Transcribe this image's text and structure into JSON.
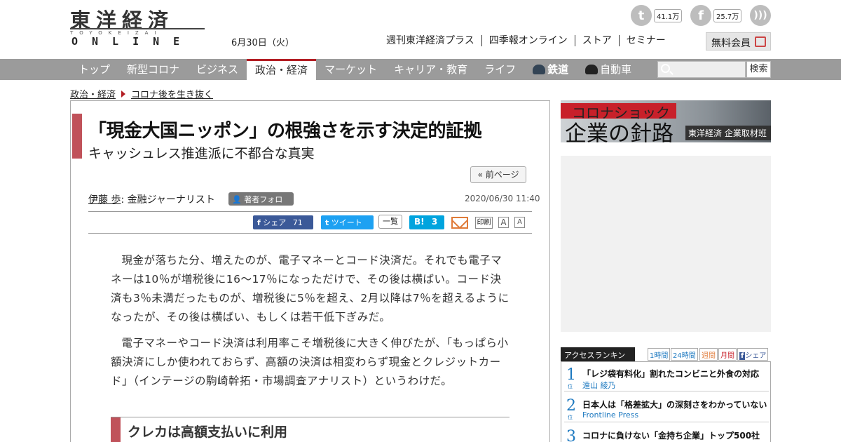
{
  "header": {
    "logo_kanji": "東洋経済",
    "logo_sub": "TOYOKEIZAI",
    "logo_online": "ONLINE",
    "date": "6月30日（火）",
    "links": [
      "週刊東洋経済プラス",
      "四季報オンライン",
      "ストア",
      "セミナー"
    ],
    "twitter_count": "41.1万",
    "facebook_count": "25.7万",
    "member_label": "無料会員"
  },
  "nav": {
    "items": [
      "トップ",
      "新型コロナ",
      "ビジネス",
      "政治・経済",
      "マーケット",
      "キャリア・教育",
      "ライフ"
    ],
    "railway": "鉄道",
    "car": "自動車",
    "active": "政治・経済",
    "search_label": "検索"
  },
  "breadcrumb": [
    "政治・経済",
    "コロナ後を生き抜く"
  ],
  "article": {
    "title": "「現金大国ニッポン」の根強さを示す決定的証拠",
    "subtitle": "キャッシュレス推進派に不都合な真実",
    "prev_label": "« 前ページ",
    "author_name": "伊藤 歩",
    "author_role": ": 金融ジャーナリスト",
    "follow_label": "著者フォロー",
    "published": "2020/06/30 11:40",
    "share": {
      "fb_label": "シェア",
      "fb_count": "71",
      "tw_label": "ツイート",
      "list_label": "一覧",
      "hb_count": "3",
      "print_label": "印刷",
      "font_a": "A"
    },
    "paragraphs": [
      "現金が落ちた分、増えたのが、電子マネーとコード決済だ。それでも電子マネーは10％が増税後に16～17％になっただけで、その後は横ばい。コード決済も3％未満だったものが、増税後に5％を超え、2月以降は7％を超えるようになったが、その後は横ばい、もしくは若干低下ぎみだ。",
      "電子マネーやコード決済は利用率こそ増税後に大きく伸びたが、「もっぱら小額決済にしか使われておらず、高額の決済は相変わらず現金とクレジットカード」（インテージの駒崎幹拓・市場調査アナリスト）というわけだ。"
    ],
    "section_heading": "クレカは高額支払いに利用"
  },
  "sidebar": {
    "banner_line1": "コロナショック",
    "banner_line2": "企業の針路",
    "banner_caption": "東洋経済 企業取材班",
    "ranking_label": "アクセスランキング",
    "ranking_tabs": [
      "1時間",
      "24時間",
      "週間",
      "月間",
      "シェア"
    ],
    "rank_suffix": "位",
    "ranking": [
      {
        "rank": "1",
        "title": "「レジ袋有料化」割れたコンビニと外食の対応",
        "author": "遠山 綾乃"
      },
      {
        "rank": "2",
        "title": "日本人は「格差拡大」の深刻さをわかっていない",
        "author": "Frontline Press"
      },
      {
        "rank": "3",
        "title": "コロナに負けない「金持ち企業」トップ500社",
        "author": ""
      }
    ]
  }
}
